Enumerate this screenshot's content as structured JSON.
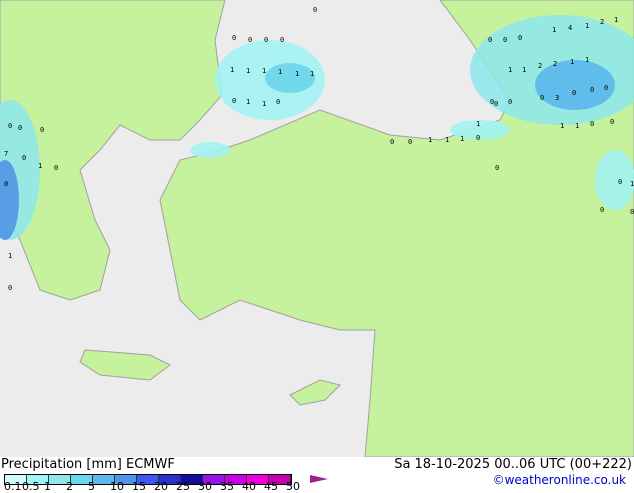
{
  "header": {
    "title": "Precipitation [mm]  ECMWF",
    "date": "Sa 18-10-2025 00..06 UTC (00+222)",
    "credit": "©weatheronline.co.uk"
  },
  "colors": {
    "land": "#c6f29e",
    "sea": "#ececec",
    "border": "#a0a0a0"
  },
  "legend": {
    "labels": [
      "0.1",
      "0.5",
      "1",
      "2",
      "5",
      "10",
      "15",
      "20",
      "25",
      "30",
      "35",
      "40",
      "45",
      "50"
    ],
    "colors": [
      "#d2fafa",
      "#a0f5f5",
      "#8ce8ec",
      "#6cd6ec",
      "#5ab8ec",
      "#5096e6",
      "#3c5af0",
      "#2832c8",
      "#140c9e",
      "#9614e6",
      "#c800e6",
      "#f000dc",
      "#c800b4"
    ]
  },
  "rain_labels": [
    "0",
    "0",
    "0",
    "0",
    "0",
    "1",
    "1",
    "1",
    "1",
    "1",
    "1",
    "0",
    "1",
    "1",
    "0",
    "0",
    "0",
    "0",
    "0",
    "0",
    "0",
    "0",
    "1",
    "1",
    "1",
    "0",
    "1",
    "1",
    "2",
    "2",
    "1",
    "1",
    "1",
    "4",
    "1",
    "2",
    "1",
    "0",
    "3",
    "0",
    "0",
    "0",
    "1",
    "1",
    "0",
    "0",
    "1",
    "0",
    "0",
    "0",
    "1",
    "0",
    "0",
    "0",
    "7",
    "0",
    "1",
    "0",
    "0",
    "0",
    "1",
    "0",
    "0"
  ]
}
